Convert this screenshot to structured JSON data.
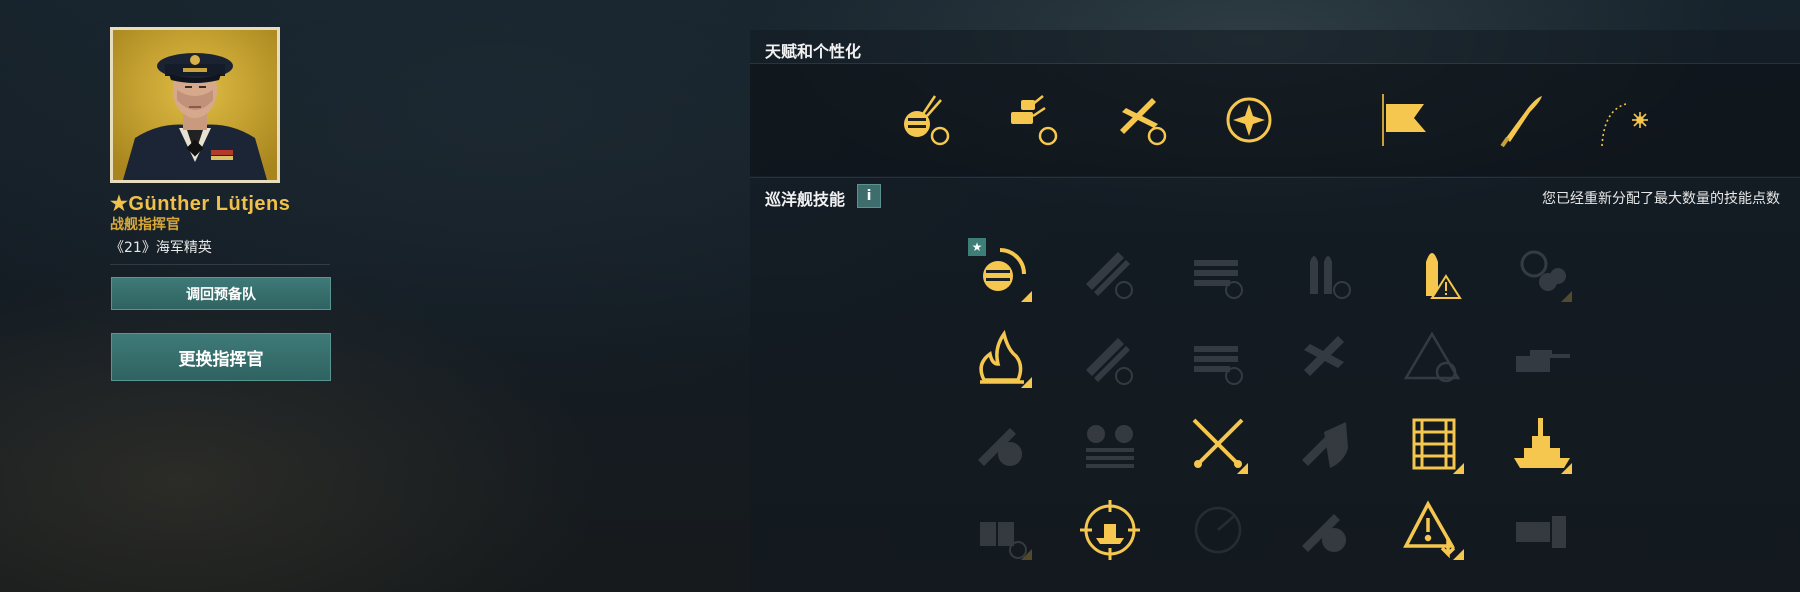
{
  "commander": {
    "name": "★Günther  Lütjens",
    "role": "战舰指挥官",
    "rank": "《21》海军精英",
    "portrait_bg": "#c9a52b"
  },
  "buttons": {
    "reserve_label": "调回预备队",
    "change_label": "更换指挥官"
  },
  "talents": {
    "title": "天赋和个性化",
    "icons": [
      "main-battery-reload-icon",
      "secondary-battery-reload-icon",
      "aircraft-reload-icon",
      "iron-cross-emblem-icon",
      "flag-icon",
      "shell-icon",
      "firework-icon"
    ]
  },
  "skills": {
    "title": "巡洋舰技能",
    "info_label": "i",
    "notice": "您已经重新分配了最大数量的技能点数",
    "rows": [
      [
        "main-battery-skill-icon",
        "torpedo-reload-icon",
        "secondary-reload-icon",
        "shell-reload-icon",
        "shell-warning-icon",
        "helm-tools-icon"
      ],
      [
        "fire-icon",
        "torpedo-reload-2-icon",
        "secondary-reload-2-icon",
        "aircraft-icon",
        "warning-target-icon",
        "ship-gun-icon"
      ],
      [
        "torpedo-fire-icon",
        "turret-rows-icon",
        "crossed-swords-icon",
        "shield-torpedo-icon",
        "ammo-rack-icon",
        "battleship-icon"
      ],
      [
        "turret-reload-icon",
        "target-ship-icon",
        "radar-icon",
        "torpedo-fire-2-icon",
        "warning-down-icon",
        "secondary-grid-icon"
      ]
    ],
    "accent": "#f5c74e"
  }
}
